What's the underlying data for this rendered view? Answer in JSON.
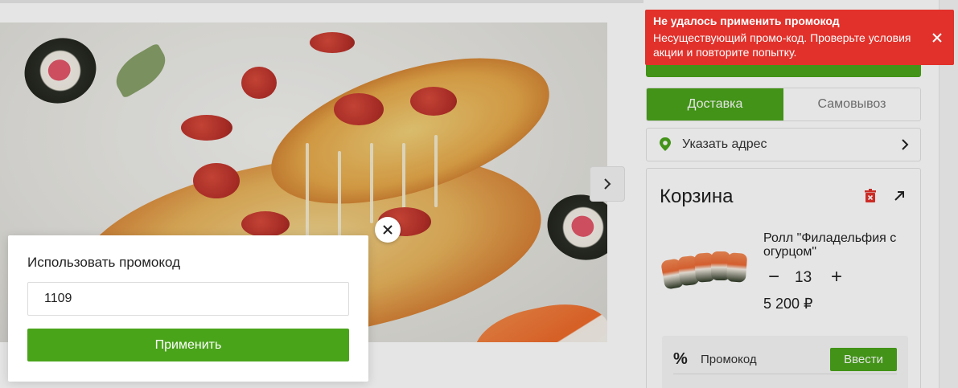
{
  "delivery": {
    "tabs": [
      {
        "label": "Доставка",
        "active": true
      },
      {
        "label": "Самовывоз",
        "active": false
      }
    ],
    "address_label": "Указать адрес"
  },
  "cart": {
    "title": "Корзина",
    "item": {
      "name": "Ролл \"Филадельфия с огурцом\"",
      "quantity": "13",
      "price": "5 200 ₽",
      "minus": "−",
      "plus": "+"
    },
    "promo": {
      "icon_text": "%",
      "label": "Промокод",
      "enter_button": "Ввести"
    }
  },
  "promo_modal": {
    "title": "Использовать промокод",
    "input_value": "1109",
    "apply_button": "Применить"
  },
  "toast": {
    "title": "Не удалось применить промокод",
    "message": "Несуществующий промо-код. Проверьте условия акции и повторите попытку."
  },
  "icons": {
    "banner_next": "chevron-right-icon",
    "address_pin": "map-pin-icon",
    "address_arrow": "chevron-right-icon",
    "cart_trash": "trash-icon",
    "cart_expand": "expand-arrow-icon",
    "modal_close": "close-icon",
    "toast_close": "close-icon"
  },
  "colors": {
    "accent_green": "#4aa41a",
    "error_red": "#e2312b"
  }
}
